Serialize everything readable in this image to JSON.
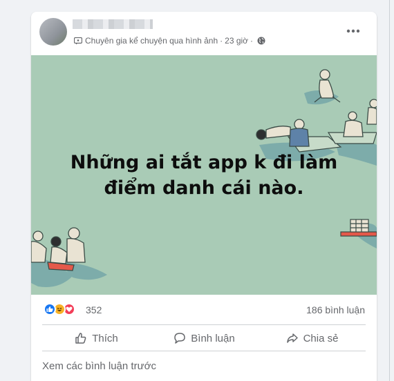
{
  "post": {
    "group_label": "Chuyên gia kể chuyện qua hình ảnh",
    "time": "23 giờ",
    "dot": "·",
    "caption_line1": "Những ai tắt app k đi làm",
    "caption_line2": "điểm danh cái nào.",
    "image_bg_color": "#a9cbb6"
  },
  "stats": {
    "reaction_count": "352",
    "comment_count": "186 bình luận",
    "reactions": [
      "like-icon",
      "haha-icon",
      "love-icon"
    ]
  },
  "actions": {
    "like_label": "Thích",
    "comment_label": "Bình luận",
    "share_label": "Chia sẻ"
  },
  "comments": {
    "view_previous_label": "Xem các bình luận trước"
  },
  "colors": {
    "accent": "#1877f2",
    "text_secondary": "#65676b",
    "love": "#f33e58",
    "haha": "#f7b125"
  }
}
